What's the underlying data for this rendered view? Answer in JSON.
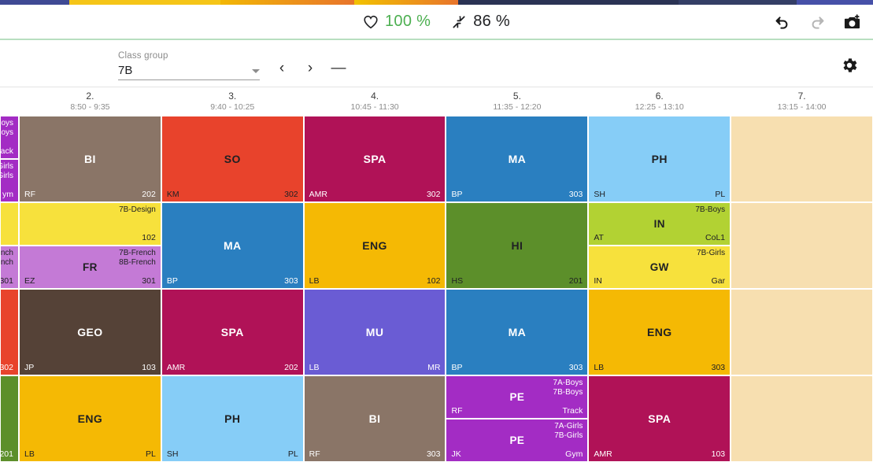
{
  "top_strip": {
    "segments": [
      "#3f4a94",
      "#f5c518",
      "#e8742c",
      "#f2c200",
      "#2b3354",
      "#343e66",
      "#4650a8"
    ]
  },
  "header": {
    "stats": [
      {
        "icon": "heart-icon",
        "value": "100 %",
        "color": "#4caf50"
      },
      {
        "icon": "compress-arrows-icon",
        "value": "86 %",
        "color": "#202124"
      }
    ],
    "actions": [
      {
        "icon": "undo-icon",
        "label": "Undo",
        "enabled": true
      },
      {
        "icon": "redo-icon",
        "label": "Redo",
        "enabled": false
      },
      {
        "icon": "camera-icon",
        "label": "Screenshot",
        "enabled": true
      }
    ]
  },
  "controls": {
    "select_label": "Class group",
    "select_value": "7B",
    "prev_label": "‹",
    "next_label": "›",
    "minus_label": "—",
    "settings_icon": "gear-icon"
  },
  "timetable": {
    "columns": [
      {
        "num": "2.",
        "time": "8:50 - 9:35"
      },
      {
        "num": "3.",
        "time": "9:40 - 10:25"
      },
      {
        "num": "4.",
        "time": "10:45 - 11:30"
      },
      {
        "num": "5.",
        "time": "11:35 - 12:20"
      },
      {
        "num": "6.",
        "time": "12:25 - 13:10"
      },
      {
        "num": "7.",
        "time": "13:15 - 14:00"
      }
    ],
    "cut_column": [
      {
        "lessons": [
          {
            "subject": "",
            "teacher": "",
            "room": "ack",
            "groups": "oys\noys",
            "bg": "#a32cc4",
            "fg": "#ffffff"
          },
          {
            "subject": "",
            "teacher": "",
            "room": "ym",
            "groups": "Girls\nGirls",
            "bg": "#a32cc4",
            "fg": "#ffffff"
          }
        ]
      },
      {
        "lessons": [
          {
            "subject": "",
            "teacher": "",
            "room": "",
            "groups": "",
            "bg": "#f7e13c",
            "fg": "#202124"
          },
          {
            "subject": "",
            "teacher": "",
            "room": "301",
            "groups": "nch\nnch",
            "bg": "#c47ad6",
            "fg": "#202124"
          }
        ]
      },
      {
        "lessons": [
          {
            "subject": "",
            "teacher": "",
            "room": "302",
            "groups": "",
            "bg": "#e8432c",
            "fg": "#ffffff"
          }
        ]
      },
      {
        "lessons": [
          {
            "subject": "",
            "teacher": "",
            "room": "201",
            "groups": "",
            "bg": "#5c8f2a",
            "fg": "#ffffff"
          }
        ]
      }
    ],
    "rows": [
      [
        {
          "lessons": [
            {
              "subject": "BI",
              "teacher": "RF",
              "room": "202",
              "groups": "",
              "bg": "#8a7567",
              "fg": "#ffffff"
            }
          ]
        },
        {
          "lessons": [
            {
              "subject": "SO",
              "teacher": "KM",
              "room": "302",
              "groups": "",
              "bg": "#e8432c",
              "fg": "#202124"
            }
          ]
        },
        {
          "lessons": [
            {
              "subject": "SPA",
              "teacher": "AMR",
              "room": "302",
              "groups": "",
              "bg": "#b01257",
              "fg": "#ffffff"
            }
          ]
        },
        {
          "lessons": [
            {
              "subject": "MA",
              "teacher": "BP",
              "room": "303",
              "groups": "",
              "bg": "#2a7fc0",
              "fg": "#ffffff"
            }
          ]
        },
        {
          "lessons": [
            {
              "subject": "PH",
              "teacher": "SH",
              "room": "PL",
              "groups": "",
              "bg": "#86cdf7",
              "fg": "#202124"
            }
          ]
        },
        {
          "lessons": [],
          "empty": true
        }
      ],
      [
        {
          "lessons": [
            {
              "subject": "",
              "teacher": "",
              "room": "102",
              "groups": "7B-Design",
              "bg": "#f7e13c",
              "fg": "#202124"
            },
            {
              "subject": "FR",
              "teacher": "EZ",
              "room": "301",
              "groups": "7B-French\n8B-French",
              "bg": "#c47ad6",
              "fg": "#202124"
            }
          ]
        },
        {
          "lessons": [
            {
              "subject": "MA",
              "teacher": "BP",
              "room": "303",
              "groups": "",
              "bg": "#2a7fc0",
              "fg": "#ffffff"
            }
          ]
        },
        {
          "lessons": [
            {
              "subject": "ENG",
              "teacher": "LB",
              "room": "102",
              "groups": "",
              "bg": "#f5b904",
              "fg": "#202124"
            }
          ]
        },
        {
          "lessons": [
            {
              "subject": "HI",
              "teacher": "HS",
              "room": "201",
              "groups": "",
              "bg": "#5c8f2a",
              "fg": "#202124"
            }
          ]
        },
        {
          "lessons": [
            {
              "subject": "IN",
              "teacher": "AT",
              "room": "CoL1",
              "groups": "7B-Boys",
              "bg": "#b2d233",
              "fg": "#202124"
            },
            {
              "subject": "GW",
              "teacher": "IN",
              "room": "Gar",
              "groups": "7B-Girls",
              "bg": "#f7e13c",
              "fg": "#202124"
            }
          ]
        },
        {
          "lessons": [],
          "empty": true
        }
      ],
      [
        {
          "lessons": [
            {
              "subject": "GEO",
              "teacher": "JP",
              "room": "103",
              "groups": "",
              "bg": "#554237",
              "fg": "#ffffff"
            }
          ]
        },
        {
          "lessons": [
            {
              "subject": "SPA",
              "teacher": "AMR",
              "room": "202",
              "groups": "",
              "bg": "#b01257",
              "fg": "#ffffff"
            }
          ]
        },
        {
          "lessons": [
            {
              "subject": "MU",
              "teacher": "LB",
              "room": "MR",
              "groups": "",
              "bg": "#6a5cd4",
              "fg": "#ffffff"
            }
          ]
        },
        {
          "lessons": [
            {
              "subject": "MA",
              "teacher": "BP",
              "room": "303",
              "groups": "",
              "bg": "#2a7fc0",
              "fg": "#ffffff"
            }
          ]
        },
        {
          "lessons": [
            {
              "subject": "ENG",
              "teacher": "LB",
              "room": "303",
              "groups": "",
              "bg": "#f5b904",
              "fg": "#202124"
            }
          ]
        },
        {
          "lessons": [],
          "empty": true
        }
      ],
      [
        {
          "lessons": [
            {
              "subject": "ENG",
              "teacher": "LB",
              "room": "PL",
              "groups": "",
              "bg": "#f5b904",
              "fg": "#202124"
            }
          ]
        },
        {
          "lessons": [
            {
              "subject": "PH",
              "teacher": "SH",
              "room": "PL",
              "groups": "",
              "bg": "#86cdf7",
              "fg": "#202124"
            }
          ]
        },
        {
          "lessons": [
            {
              "subject": "BI",
              "teacher": "RF",
              "room": "303",
              "groups": "",
              "bg": "#8a7567",
              "fg": "#ffffff"
            }
          ]
        },
        {
          "lessons": [
            {
              "subject": "PE",
              "teacher": "RF",
              "room": "Track",
              "groups": "7A-Boys\n7B-Boys",
              "bg": "#a32cc4",
              "fg": "#ffffff"
            },
            {
              "subject": "PE",
              "teacher": "JK",
              "room": "Gym",
              "groups": "7A-Girls\n7B-Girls",
              "bg": "#a32cc4",
              "fg": "#ffffff"
            }
          ]
        },
        {
          "lessons": [
            {
              "subject": "SPA",
              "teacher": "AMR",
              "room": "103",
              "groups": "",
              "bg": "#b01257",
              "fg": "#ffffff"
            }
          ]
        },
        {
          "lessons": [],
          "empty": true
        }
      ]
    ]
  }
}
